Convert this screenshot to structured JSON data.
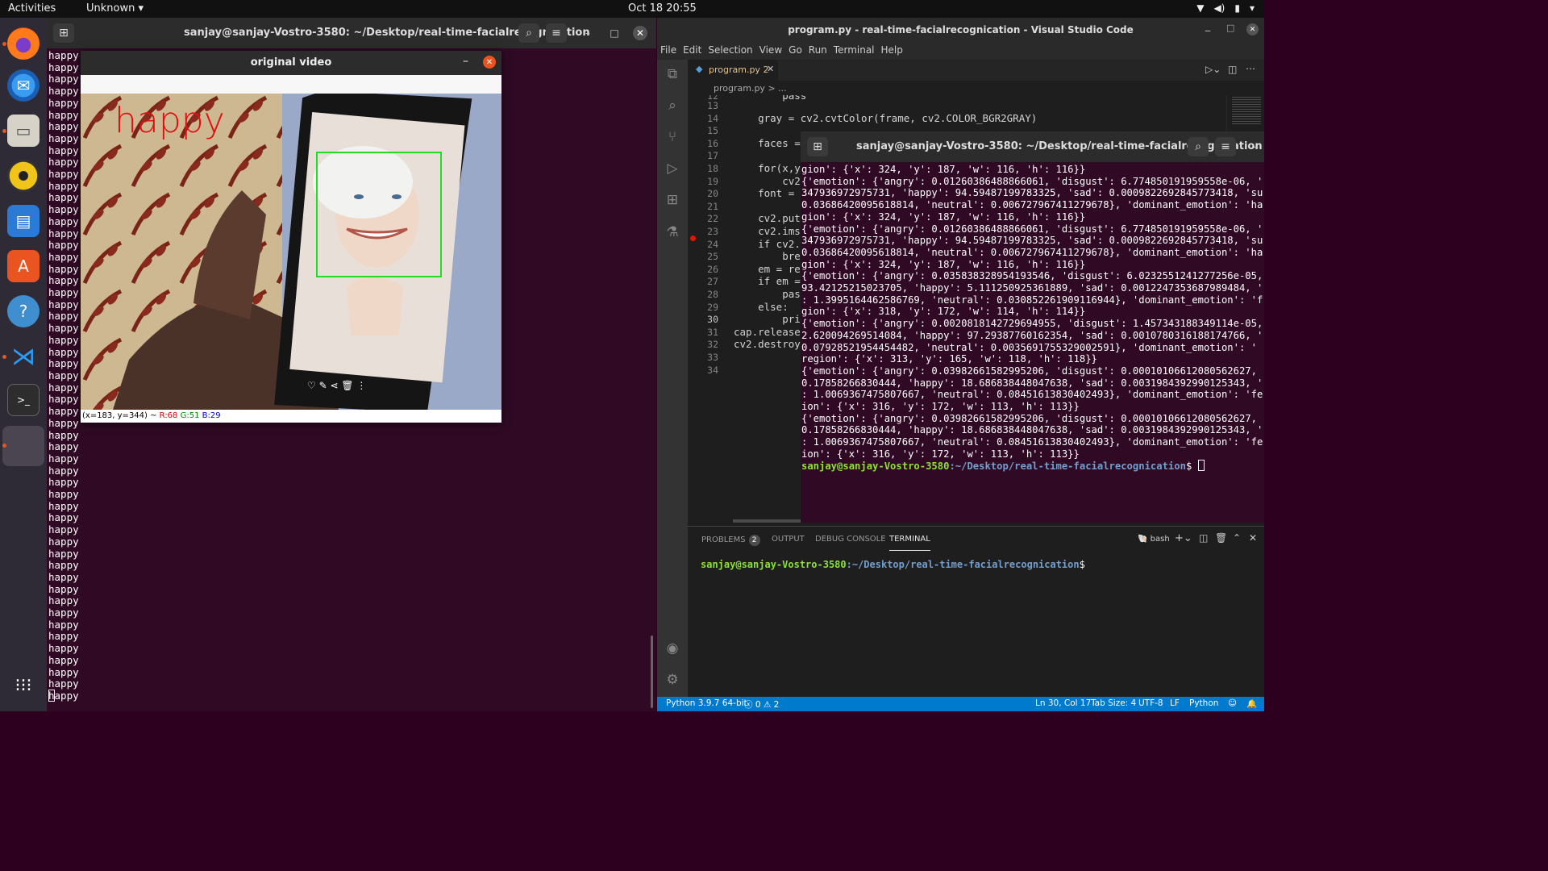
{
  "topbar": {
    "activities": "Activities",
    "app_menu": "Unknown",
    "clock": "Oct 18  20:55"
  },
  "left_terminal": {
    "title": "sanjay@sanjay-Vostro-3580: ~/Desktop/real-time-facialrecognication",
    "lines": [
      "happy",
      "happy",
      "happy",
      "happy",
      "happy",
      "happy",
      "happy",
      "happy",
      "happy",
      "happy",
      "happy",
      "happy",
      "happy",
      "happy",
      "happy",
      "happy",
      "happy",
      "happy",
      "happy",
      "happy",
      "happy",
      "happy",
      "happy",
      "happy",
      "happy",
      "happy",
      "happy",
      "happy",
      "happy",
      "happy",
      "happy",
      "happy",
      "happy",
      "happy",
      "happy",
      "happy",
      "happy",
      "happy",
      "happy",
      "happy",
      "happy",
      "happy",
      "happy",
      "happy",
      "happy",
      "happy",
      "happy",
      "happy",
      "happy",
      "happy",
      "happy",
      "happy",
      "happy",
      "happy",
      "happy"
    ]
  },
  "video_window": {
    "title": "original video",
    "overlay_label": "happy",
    "status_coords": "(x=183, y=344) ~ ",
    "status_r": "R:68",
    "status_g": "G:51",
    "status_b": "B:29"
  },
  "vscode": {
    "title": "program.py - real-time-facialrecognication - Visual Studio Code",
    "menu": [
      "File",
      "Edit",
      "Selection",
      "View",
      "Go",
      "Run",
      "Terminal",
      "Help"
    ],
    "tab": "program.py 2",
    "breadcrumb": "program.py > ...",
    "code": [
      {
        "n": "12",
        "t": "        pass"
      },
      {
        "n": "13",
        "t": ""
      },
      {
        "n": "14",
        "t": "    gray = cv2.cvtColor(frame, cv2.COLOR_BGR2GRAY)"
      },
      {
        "n": "15",
        "t": ""
      },
      {
        "n": "16",
        "t": "    faces = "
      },
      {
        "n": "17",
        "t": ""
      },
      {
        "n": "18",
        "t": "    for(x,y,"
      },
      {
        "n": "19",
        "t": "        cv2."
      },
      {
        "n": "20",
        "t": "    font = c"
      },
      {
        "n": "21",
        "t": ""
      },
      {
        "n": "22",
        "t": "    cv2.putT"
      },
      {
        "n": "23",
        "t": "    cv2.imsh"
      },
      {
        "n": "24",
        "t": "    if cv2.w"
      },
      {
        "n": "25",
        "t": "        brea"
      },
      {
        "n": "26",
        "t": "    em = res"
      },
      {
        "n": "27",
        "t": "    if em =="
      },
      {
        "n": "28",
        "t": "        pass"
      },
      {
        "n": "29",
        "t": "    else:"
      },
      {
        "n": "30",
        "t": "        prin"
      },
      {
        "n": "31",
        "t": "cap.release("
      },
      {
        "n": "32",
        "t": "cv2.destroyA"
      },
      {
        "n": "33",
        "t": ""
      },
      {
        "n": "34",
        "t": ""
      }
    ],
    "panel_tabs": {
      "problems": "PROBLEMS",
      "problems_count": "2",
      "output": "OUTPUT",
      "debug": "DEBUG CONSOLE",
      "terminal": "TERMINAL",
      "shell": "bash"
    },
    "panel_prompt_user": "sanjay@sanjay-Vostro-3580",
    "panel_prompt_path": ":~/Desktop/real-time-facialrecognication",
    "panel_prompt_end": "$",
    "status": {
      "python": "Python 3.9.7 64-bit",
      "problems": "ⓧ 0 ⚠ 2",
      "position": "Ln 30, Col 17",
      "tabsize": "Tab Size: 4",
      "encoding": "UTF-8",
      "eol": "LF",
      "language": "Python"
    }
  },
  "overlay_terminal": {
    "title": "sanjay@sanjay-Vostro-3580: ~/Desktop/real-time-facialrecognication",
    "log": [
      "gion': {'x': 324, 'y': 187, 'w': 116, 'h': 116}}",
      "{'emotion': {'angry': 0.01260386488866061, 'disgust': 6.774850191959558e-06, '",
      "347936972975731, 'happy': 94.59487199783325, 'sad': 0.0009822692845773418, 'su",
      "0.03686420095618814, 'neutral': 0.006727967411279678}, 'dominant_emotion': 'ha",
      "gion': {'x': 324, 'y': 187, 'w': 116, 'h': 116}}",
      "{'emotion': {'angry': 0.01260386488866061, 'disgust': 6.774850191959558e-06, '",
      "347936972975731, 'happy': 94.59487199783325, 'sad': 0.0009822692845773418, 'su",
      "0.03686420095618814, 'neutral': 0.006727967411279678}, 'dominant_emotion': 'ha",
      "gion': {'x': 324, 'y': 187, 'w': 116, 'h': 116}}",
      "{'emotion': {'angry': 0.035838328954193546, 'disgust': 6.0232551241277256e-05,",
      "93.42125215023705, 'happy': 5.111250925361889, 'sad': 0.0012247353687989484, '",
      ": 1.3995164462586769, 'neutral': 0.030852261909116944}, 'dominant_emotion': 'f",
      "gion': {'x': 318, 'y': 172, 'w': 114, 'h': 114}}",
      "{'emotion': {'angry': 0.0020818142729694955, 'disgust': 1.457343188349114e-05,",
      "2.620094269514084, 'happy': 97.29387760162354, 'sad': 0.0010780316188174766, '",
      "0.07928521954454482, 'neutral': 0.0035691755329002591}, 'dominant_emotion': '",
      "region': {'x': 313, 'y': 165, 'w': 118, 'h': 118}}",
      "{'emotion': {'angry': 0.03982661582995206, 'disgust': 0.00010106612080562627,",
      "0.17858266830444, 'happy': 18.686838448047638, 'sad': 0.0031984392990125343, '",
      ": 1.0069367475807667, 'neutral': 0.08451613830402493}, 'dominant_emotion': 'fe",
      "ion': {'x': 316, 'y': 172, 'w': 113, 'h': 113}}",
      "{'emotion': {'angry': 0.03982661582995206, 'disgust': 0.00010106612080562627,",
      "0.17858266830444, 'happy': 18.686838448047638, 'sad': 0.0031984392990125343, '",
      ": 1.0069367475807667, 'neutral': 0.08451613830402493}, 'dominant_emotion': 'fe",
      "ion': {'x': 316, 'y': 172, 'w': 113, 'h': 113}}"
    ],
    "prompt_user": "sanjay@sanjay-Vostro-3580",
    "prompt_path": ":~/Desktop/real-time-facialrecognication",
    "prompt_end": "$ "
  },
  "colors": {
    "accent": "#e95420",
    "vscode_status": "#007acc",
    "terminal_bg": "#300a24",
    "face_box": "#22dd22",
    "overlay_text": "#e01010"
  },
  "icons": [
    "firefox-icon",
    "thunderbird-icon",
    "files-icon",
    "rhythmbox-icon",
    "writer-icon",
    "software-icon",
    "help-icon",
    "vscode-icon",
    "terminal-icon",
    "apps-grid-icon"
  ]
}
